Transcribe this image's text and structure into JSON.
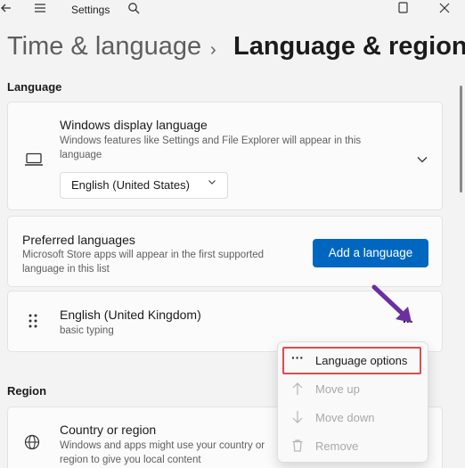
{
  "window": {
    "title": "Settings",
    "icons": {
      "back": "back-arrow-icon",
      "menu": "hamburger-icon",
      "search": "search-icon",
      "maximize": "maximize-icon",
      "close": "close-icon"
    }
  },
  "breadcrumb": {
    "parent": "Time & language",
    "separator": "›",
    "current": "Language & region"
  },
  "language_section": {
    "heading": "Language"
  },
  "display_language": {
    "title": "Windows display language",
    "description": "Windows features like Settings and File Explorer will appear in this language",
    "selected": "English (United States)",
    "icon": "laptop-icon"
  },
  "preferred_languages": {
    "title": "Preferred languages",
    "description": "Microsoft Store apps will appear in the first supported language in this list",
    "add_button": "Add a language"
  },
  "language_entry": {
    "name": "English (United Kingdom)",
    "detail": "basic typing",
    "more": "..."
  },
  "context_menu": {
    "items": [
      {
        "label": "Language options",
        "icon": "more-dots-icon",
        "enabled": true
      },
      {
        "label": "Move up",
        "icon": "arrow-up-icon",
        "enabled": false
      },
      {
        "label": "Move down",
        "icon": "arrow-down-icon",
        "enabled": false
      },
      {
        "label": "Remove",
        "icon": "trash-icon",
        "enabled": false
      }
    ]
  },
  "region_section": {
    "heading": "Region"
  },
  "country_region": {
    "title": "Country or region",
    "description": "Windows and apps might use your country or region to give you local content",
    "icon": "globe-icon"
  },
  "colors": {
    "accent": "#0067c0",
    "annotation_box": "#e04b4b",
    "annotation_arrow": "#6b2fa0"
  }
}
